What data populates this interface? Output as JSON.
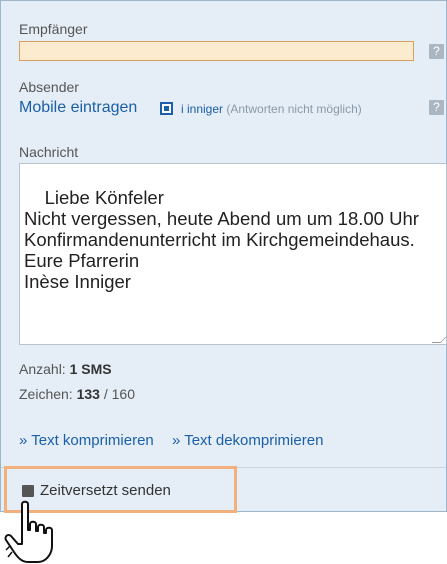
{
  "recipient": {
    "label": "Empfänger",
    "value": "",
    "help": "?"
  },
  "sender": {
    "label": "Absender",
    "add_link": "Mobile eintragen",
    "name": "i inniger",
    "note": "(Antworten nicht möglich)",
    "help": "?"
  },
  "message": {
    "label": "Nachricht",
    "text": "Liebe Könfeler\nNicht vergessen, heute Abend um um 18.00 Uhr Konfirmandenunterricht im Kirchgemeindehaus.\nEure Pfarrerin\nInèse Inniger"
  },
  "stats": {
    "count_label": "Anzahl:",
    "count_value": "1 SMS",
    "chars_label": "Zeichen:",
    "chars_value": "133",
    "chars_limit": "/ 160"
  },
  "actions": {
    "compress": "» Text komprimieren",
    "decompress": "» Text dekomprimieren"
  },
  "delayed": {
    "label": "Zeitversetzt senden"
  },
  "colors": {
    "panel": "#e5eef6",
    "link": "#1b5fa8",
    "highlight": "#f2b07c",
    "recipient_bg": "#fdebd0"
  },
  "icons": {
    "cursor": "hand-pointer-icon",
    "help": "question-icon"
  }
}
